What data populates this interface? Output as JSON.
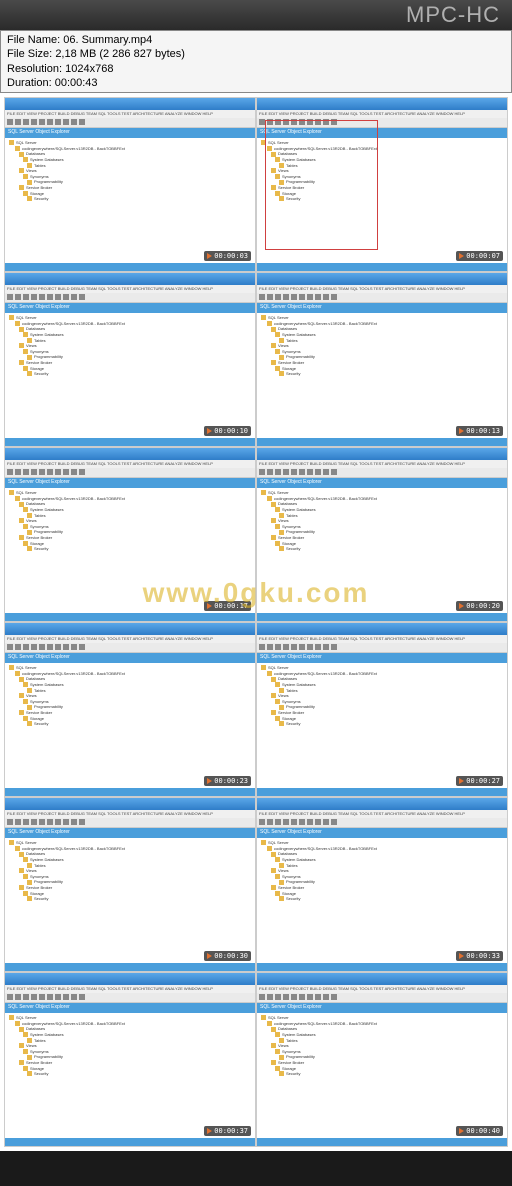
{
  "player": {
    "brand": "MPC-HC"
  },
  "fileinfo": {
    "filename_label": "File Name:",
    "filename": "06. Summary.mp4",
    "filesize_label": "File Size:",
    "filesize": "2,18 MB (2 286 827 bytes)",
    "resolution_label": "Resolution:",
    "resolution": "1024x768",
    "duration_label": "Duration:",
    "duration": "00:00:43"
  },
  "watermark_text": "www.0gku.com",
  "menu_items": "FILE  EDIT  VIEW  PROJECT  BUILD  DEBUG  TEAM  SQL  TOOLS  TEST  ARCHITECTURE  ANALYZE  WINDOW  HELP",
  "panel_title": "SQL Server Object Explorer",
  "tree_root": "SQL Server",
  "tree_server": "codingeverywhere/SQLServer.v13R2DB - BackTOBBFExt",
  "tree_nodes": [
    "Databases",
    "System Databases",
    "Tables",
    "Views",
    "Synonyms",
    "Programmability",
    "Service Broker",
    "Storage",
    "Security"
  ],
  "thumbnails": [
    {
      "timestamp": "00:00:03",
      "highlighted": false
    },
    {
      "timestamp": "00:00:07",
      "highlighted": true
    },
    {
      "timestamp": "00:00:10",
      "highlighted": false
    },
    {
      "timestamp": "00:00:13",
      "highlighted": false
    },
    {
      "timestamp": "00:00:17",
      "highlighted": false
    },
    {
      "timestamp": "00:00:20",
      "highlighted": false
    },
    {
      "timestamp": "00:00:23",
      "highlighted": false
    },
    {
      "timestamp": "00:00:27",
      "highlighted": false
    },
    {
      "timestamp": "00:00:30",
      "highlighted": false
    },
    {
      "timestamp": "00:00:33",
      "highlighted": false
    },
    {
      "timestamp": "00:00:37",
      "highlighted": false
    },
    {
      "timestamp": "00:00:40",
      "highlighted": false
    }
  ]
}
